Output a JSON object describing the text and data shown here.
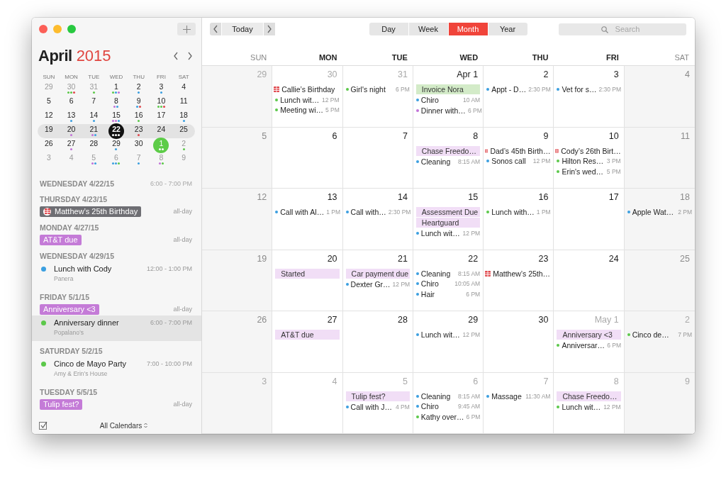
{
  "sidebar": {
    "month": "April",
    "year": "2015",
    "weekdays": [
      "SUN",
      "MON",
      "TUE",
      "WED",
      "THU",
      "FRI",
      "SAT"
    ],
    "weeks": [
      {
        "days": [
          {
            "label": "29",
            "muted": true,
            "selected": false,
            "today": false
          },
          {
            "label": "30",
            "muted": true,
            "selected": false,
            "today": false,
            "dots": [
              {
                "color": "#5cc84a"
              },
              {
                "color": "#5cc84a"
              },
              {
                "color": "#e0474c"
              }
            ]
          },
          {
            "label": "31",
            "muted": true,
            "selected": false,
            "today": false,
            "dots": [
              {
                "color": "#5cc84a"
              }
            ]
          },
          {
            "label": "1",
            "muted": false,
            "selected": false,
            "today": false,
            "dots": [
              {
                "color": "#5cc84a"
              },
              {
                "color": "#3b9fe0"
              },
              {
                "color": "#c273d8"
              }
            ]
          },
          {
            "label": "2",
            "muted": false,
            "selected": false,
            "today": false,
            "dots": [
              {
                "color": "#3b9fe0"
              }
            ]
          },
          {
            "label": "3",
            "muted": false,
            "selected": false,
            "today": false,
            "dots": [
              {
                "color": "#3b9fe0"
              }
            ]
          },
          {
            "label": "4",
            "muted": false,
            "selected": false,
            "today": false
          }
        ]
      },
      {
        "days": [
          {
            "label": "5",
            "muted": false,
            "selected": false,
            "today": false
          },
          {
            "label": "6",
            "muted": false,
            "selected": false,
            "today": false
          },
          {
            "label": "7",
            "muted": false,
            "selected": false,
            "today": false
          },
          {
            "label": "8",
            "muted": false,
            "selected": false,
            "today": false,
            "dots": [
              {
                "color": "#c273d8"
              },
              {
                "color": "#3b9fe0"
              }
            ]
          },
          {
            "label": "9",
            "muted": false,
            "selected": false,
            "today": false,
            "dots": [
              {
                "color": "#3b9fe0"
              },
              {
                "color": "#e0474c"
              }
            ]
          },
          {
            "label": "10",
            "muted": false,
            "selected": false,
            "today": false,
            "dots": [
              {
                "color": "#5cc84a"
              },
              {
                "color": "#5cc84a"
              },
              {
                "color": "#e0474c"
              }
            ]
          },
          {
            "label": "11",
            "muted": false,
            "selected": false,
            "today": false
          }
        ]
      },
      {
        "days": [
          {
            "label": "12",
            "muted": false,
            "selected": false,
            "today": false
          },
          {
            "label": "13",
            "muted": false,
            "selected": false,
            "today": false,
            "dots": [
              {
                "color": "#3b9fe0"
              }
            ]
          },
          {
            "label": "14",
            "muted": false,
            "selected": false,
            "today": false,
            "dots": [
              {
                "color": "#3b9fe0"
              }
            ]
          },
          {
            "label": "15",
            "muted": false,
            "selected": false,
            "today": false,
            "dots": [
              {
                "color": "#c273d8"
              },
              {
                "color": "#c273d8"
              },
              {
                "color": "#3b9fe0"
              }
            ]
          },
          {
            "label": "16",
            "muted": false,
            "selected": false,
            "today": false,
            "dots": [
              {
                "color": "#5cc84a"
              }
            ]
          },
          {
            "label": "17",
            "muted": false,
            "selected": false,
            "today": false
          },
          {
            "label": "18",
            "muted": false,
            "selected": false,
            "today": false,
            "dots": [
              {
                "color": "#3b9fe0"
              }
            ]
          }
        ]
      },
      {
        "days": [
          {
            "label": "19",
            "muted": false,
            "selected": false,
            "today": false
          },
          {
            "label": "20",
            "muted": false,
            "selected": false,
            "today": false,
            "dots": [
              {
                "color": "#c273d8"
              }
            ]
          },
          {
            "label": "21",
            "muted": false,
            "selected": false,
            "today": false,
            "dots": [
              {
                "color": "#c273d8"
              },
              {
                "color": "#3b9fe0"
              }
            ]
          },
          {
            "label": "22",
            "muted": false,
            "selected": true,
            "today": false,
            "dots": [
              {
                "color": "#ffffff"
              },
              {
                "color": "#ffffff"
              },
              {
                "color": "#ffffff"
              }
            ]
          },
          {
            "label": "23",
            "muted": false,
            "selected": false,
            "today": false,
            "dots": [
              {
                "color": "#e0474c"
              }
            ]
          },
          {
            "label": "24",
            "muted": false,
            "selected": false,
            "today": false
          },
          {
            "label": "25",
            "muted": false,
            "selected": false,
            "today": false
          }
        ]
      },
      {
        "days": [
          {
            "label": "26",
            "muted": false,
            "selected": false,
            "today": false
          },
          {
            "label": "27",
            "muted": false,
            "selected": false,
            "today": false,
            "dots": [
              {
                "color": "#c273d8"
              }
            ]
          },
          {
            "label": "28",
            "muted": false,
            "selected": false,
            "today": false
          },
          {
            "label": "29",
            "muted": false,
            "selected": false,
            "today": false,
            "dots": [
              {
                "color": "#3b9fe0"
              }
            ]
          },
          {
            "label": "30",
            "muted": false,
            "selected": false,
            "today": false
          },
          {
            "label": "1",
            "muted": true,
            "selected": false,
            "today": true,
            "dots": [
              {
                "color": "#ffffff"
              },
              {
                "color": "#ffffff"
              }
            ]
          },
          {
            "label": "2",
            "muted": true,
            "selected": false,
            "today": false,
            "dots": [
              {
                "color": "#5cc84a"
              }
            ]
          }
        ]
      },
      {
        "days": [
          {
            "label": "3",
            "muted": true,
            "selected": false,
            "today": false
          },
          {
            "label": "4",
            "muted": true,
            "selected": false,
            "today": false
          },
          {
            "label": "5",
            "muted": true,
            "selected": false,
            "today": false,
            "dots": [
              {
                "color": "#c273d8"
              },
              {
                "color": "#3b9fe0"
              }
            ]
          },
          {
            "label": "6",
            "muted": true,
            "selected": false,
            "today": false,
            "dots": [
              {
                "color": "#3b9fe0"
              },
              {
                "color": "#3b9fe0"
              },
              {
                "color": "#5cc84a"
              }
            ]
          },
          {
            "label": "7",
            "muted": true,
            "selected": false,
            "today": false,
            "dots": [
              {
                "color": "#3b9fe0"
              }
            ]
          },
          {
            "label": "8",
            "muted": true,
            "selected": false,
            "today": false,
            "dots": [
              {
                "color": "#c273d8"
              },
              {
                "color": "#5cc84a"
              }
            ]
          },
          {
            "label": "9",
            "muted": true,
            "selected": false,
            "today": false
          }
        ]
      }
    ],
    "agenda": [
      {
        "date": "WEDNESDAY 4/22/15",
        "peek_time": "6:00 - 7:00 PM"
      },
      {
        "date": "THURSDAY 4/23/15",
        "events": [
          {
            "kind": "birthday",
            "title": "Matthew’s 25th Birthday",
            "time": "all-day",
            "color": "#6e6e73",
            "selected": false
          }
        ]
      },
      {
        "date": "MONDAY 4/27/15",
        "events": [
          {
            "kind": "allday",
            "title": "AT&T due",
            "time": "all-day",
            "color": "#c47bd7",
            "selected": false
          }
        ]
      },
      {
        "date": "WEDNESDAY 4/29/15",
        "events": [
          {
            "kind": "timed",
            "title": "Lunch with Cody",
            "time": "12:00 - 1:00 PM",
            "location": "Panera",
            "color": "#3b9fe0",
            "selected": false
          }
        ]
      },
      {
        "date": "FRIDAY 5/1/15",
        "events": [
          {
            "kind": "allday",
            "title": "Anniversary <3",
            "time": "all-day",
            "color": "#c47bd7",
            "selected": false
          },
          {
            "kind": "timed",
            "title": "Anniversary dinner",
            "time": "6:00 - 7:00 PM",
            "location": "Popalano’s",
            "color": "#5cc84a",
            "selected": true
          }
        ]
      },
      {
        "date": "SATURDAY 5/2/15",
        "events": [
          {
            "kind": "timed",
            "title": "Cinco de Mayo Party",
            "time": "7:00 - 10:00 PM",
            "location": "Amy & Erin’s House",
            "color": "#5cc84a",
            "selected": false
          }
        ]
      },
      {
        "date": "TUESDAY 5/5/15",
        "events": [
          {
            "kind": "allday",
            "title": "Tulip fest?",
            "time": "all-day",
            "color": "#c47bd7",
            "selected": false
          }
        ]
      }
    ],
    "footer": {
      "label": "All Calendars"
    }
  },
  "toolbar": {
    "today": "Today",
    "views": [
      {
        "label": "Day",
        "selected": false
      },
      {
        "label": "Week",
        "selected": false
      },
      {
        "label": "Month",
        "selected": true
      },
      {
        "label": "Year",
        "selected": false
      }
    ],
    "search": {
      "placeholder": "Search"
    }
  },
  "month_grid": {
    "weekdays": [
      "SUN",
      "MON",
      "TUE",
      "WED",
      "THU",
      "FRI",
      "SAT"
    ],
    "weeks": [
      {
        "days": [
          {
            "label": "29",
            "muted": true
          },
          {
            "label": "30",
            "muted": true,
            "events": [
              {
                "kind": "birthday",
                "title": "Callie’s Birthday"
              },
              {
                "kind": "timed",
                "title": "Lunch wit…",
                "time": "12 PM",
                "color": "#5cc84a"
              },
              {
                "kind": "timed",
                "title": "Meeting wi…",
                "time": "5 PM",
                "color": "#5cc84a"
              }
            ]
          },
          {
            "label": "31",
            "muted": true,
            "events": [
              {
                "kind": "timed",
                "title": "Girl's night",
                "time": "6 PM",
                "color": "#5cc84a"
              }
            ]
          },
          {
            "label": "Apr 1",
            "muted": false,
            "events": [
              {
                "kind": "allday",
                "title": "Invoice Nora",
                "color": "#d3ebc8"
              },
              {
                "kind": "timed",
                "title": "Chiro",
                "time": "10 AM",
                "color": "#3b9fe0"
              },
              {
                "kind": "timed",
                "title": "Dinner with…",
                "time": "6 PM",
                "color": "#c273d8"
              }
            ]
          },
          {
            "label": "2",
            "muted": false,
            "events": [
              {
                "kind": "timed",
                "title": "Appt - D…",
                "time": "2:30 PM",
                "color": "#3b9fe0"
              }
            ]
          },
          {
            "label": "3",
            "muted": false,
            "events": [
              {
                "kind": "timed",
                "title": "Vet for s…",
                "time": "2:30 PM",
                "color": "#3b9fe0"
              }
            ]
          },
          {
            "label": "4",
            "muted": false
          }
        ]
      },
      {
        "days": [
          {
            "label": "5",
            "muted": false
          },
          {
            "label": "6",
            "muted": false
          },
          {
            "label": "7",
            "muted": false
          },
          {
            "label": "8",
            "muted": false,
            "events": [
              {
                "kind": "allday",
                "title": "Chase Freedo…",
                "color": "#f1def6"
              },
              {
                "kind": "timed",
                "title": "Cleaning",
                "time": "8:15 AM",
                "color": "#3b9fe0"
              }
            ]
          },
          {
            "label": "9",
            "muted": false,
            "events": [
              {
                "kind": "birthday",
                "title": "Dad’s 45th Birth…"
              },
              {
                "kind": "timed",
                "title": "Sonos call",
                "time": "12 PM",
                "color": "#3b9fe0"
              }
            ]
          },
          {
            "label": "10",
            "muted": false,
            "events": [
              {
                "kind": "birthday",
                "title": "Cody’s 26th Birt…"
              },
              {
                "kind": "timed",
                "title": "Hilton Res…",
                "time": "3 PM",
                "color": "#5cc84a"
              },
              {
                "kind": "timed",
                "title": "Erin's wed…",
                "time": "5 PM",
                "color": "#5cc84a"
              }
            ]
          },
          {
            "label": "11",
            "muted": false
          }
        ]
      },
      {
        "days": [
          {
            "label": "12",
            "muted": false
          },
          {
            "label": "13",
            "muted": false,
            "events": [
              {
                "kind": "timed",
                "title": "Call with Al…",
                "time": "1 PM",
                "color": "#3b9fe0"
              }
            ]
          },
          {
            "label": "14",
            "muted": false,
            "events": [
              {
                "kind": "timed",
                "title": "Call with…",
                "time": "2:30 PM",
                "color": "#3b9fe0"
              }
            ]
          },
          {
            "label": "15",
            "muted": false,
            "events": [
              {
                "kind": "allday",
                "title": "Assessment Due",
                "color": "#f1def6"
              },
              {
                "kind": "allday",
                "title": "Heartguard",
                "color": "#f1def6"
              },
              {
                "kind": "timed",
                "title": "Lunch wit…",
                "time": "12 PM",
                "color": "#3b9fe0"
              }
            ]
          },
          {
            "label": "16",
            "muted": false,
            "events": [
              {
                "kind": "timed",
                "title": "Lunch with…",
                "time": "1 PM",
                "color": "#5cc84a"
              }
            ]
          },
          {
            "label": "17",
            "muted": false
          },
          {
            "label": "18",
            "muted": false,
            "events": [
              {
                "kind": "timed",
                "title": "Apple Wat…",
                "time": "2 PM",
                "color": "#3b9fe0"
              }
            ]
          }
        ]
      },
      {
        "days": [
          {
            "label": "19",
            "muted": false
          },
          {
            "label": "20",
            "muted": false,
            "events": [
              {
                "kind": "allday",
                "title": "Started",
                "color": "#f1def6"
              }
            ]
          },
          {
            "label": "21",
            "muted": false,
            "events": [
              {
                "kind": "allday",
                "title": "Car payment due",
                "color": "#f1def6"
              },
              {
                "kind": "timed",
                "title": "Dexter Gr…",
                "time": "12 PM",
                "color": "#3b9fe0"
              }
            ]
          },
          {
            "label": "22",
            "muted": false,
            "events": [
              {
                "kind": "timed",
                "title": "Cleaning",
                "time": "8:15 AM",
                "color": "#3b9fe0"
              },
              {
                "kind": "timed",
                "title": "Chiro",
                "time": "10:05 AM",
                "color": "#3b9fe0"
              },
              {
                "kind": "timed",
                "title": "Hair",
                "time": "6 PM",
                "color": "#3b9fe0"
              }
            ]
          },
          {
            "label": "23",
            "muted": false,
            "events": [
              {
                "kind": "birthday",
                "title": "Matthew’s 25th…"
              }
            ]
          },
          {
            "label": "24",
            "muted": false
          },
          {
            "label": "25",
            "muted": false
          }
        ]
      },
      {
        "days": [
          {
            "label": "26",
            "muted": false
          },
          {
            "label": "27",
            "muted": false,
            "events": [
              {
                "kind": "allday",
                "title": "AT&T due",
                "color": "#f1def6"
              }
            ]
          },
          {
            "label": "28",
            "muted": false
          },
          {
            "label": "29",
            "muted": false,
            "events": [
              {
                "kind": "timed",
                "title": "Lunch wit…",
                "time": "12 PM",
                "color": "#3b9fe0"
              }
            ]
          },
          {
            "label": "30",
            "muted": false
          },
          {
            "label": "May 1",
            "muted": true,
            "events": [
              {
                "kind": "allday",
                "title": "Anniversary <3",
                "color": "#f1def6"
              },
              {
                "kind": "timed",
                "title": "Anniversar…",
                "time": "6 PM",
                "color": "#5cc84a"
              }
            ]
          },
          {
            "label": "2",
            "muted": true,
            "events": [
              {
                "kind": "timed",
                "title": "Cinco de…",
                "time": "7 PM",
                "color": "#5cc84a"
              }
            ]
          }
        ]
      },
      {
        "days": [
          {
            "label": "3",
            "muted": true
          },
          {
            "label": "4",
            "muted": true
          },
          {
            "label": "5",
            "muted": true,
            "events": [
              {
                "kind": "allday",
                "title": "Tulip fest?",
                "color": "#f1def6"
              },
              {
                "kind": "timed",
                "title": "Call with J…",
                "time": "4 PM",
                "color": "#3b9fe0"
              }
            ]
          },
          {
            "label": "6",
            "muted": true,
            "events": [
              {
                "kind": "timed",
                "title": "Cleaning",
                "time": "8:15 AM",
                "color": "#3b9fe0"
              },
              {
                "kind": "timed",
                "title": "Chiro",
                "time": "9:45 AM",
                "color": "#3b9fe0"
              },
              {
                "kind": "timed",
                "title": "Kathy over…",
                "time": "6 PM",
                "color": "#5cc84a"
              }
            ]
          },
          {
            "label": "7",
            "muted": true,
            "events": [
              {
                "kind": "timed",
                "title": "Massage",
                "time": "11:30 AM",
                "color": "#3b9fe0"
              }
            ]
          },
          {
            "label": "8",
            "muted": true,
            "events": [
              {
                "kind": "allday",
                "title": "Chase Freedo…",
                "color": "#f1def6"
              },
              {
                "kind": "timed",
                "title": "Lunch wit…",
                "time": "12 PM",
                "color": "#5cc84a"
              }
            ]
          },
          {
            "label": "9",
            "muted": true
          }
        ]
      }
    ]
  }
}
